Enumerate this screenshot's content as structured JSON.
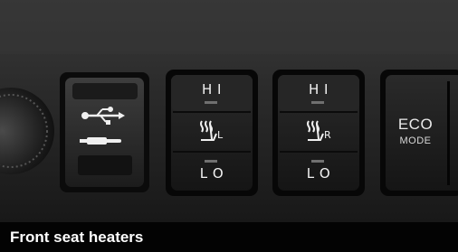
{
  "caption": "Front seat heaters",
  "switches": {
    "left": {
      "hi": "H I",
      "lo": "L O",
      "side": "L"
    },
    "right": {
      "hi": "H I",
      "lo": "L O",
      "side": "R"
    },
    "eco": {
      "line1": "ECO",
      "line2": "MODE"
    }
  },
  "icons": [
    "usb-icon",
    "aux-plug-icon",
    "seat-heater-icon"
  ],
  "colors": {
    "panel": "#2a2a2a",
    "button": "#1a1a1a",
    "caption_bg": "#000000",
    "text": "#ffffff"
  }
}
